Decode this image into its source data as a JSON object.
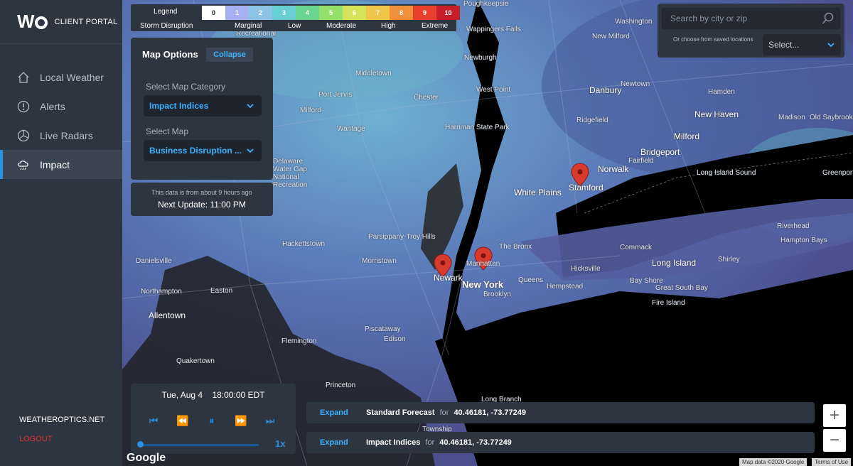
{
  "sidebar": {
    "brand_logo": "WO",
    "brand_sub": "CLIENT PORTAL",
    "items": [
      {
        "label": "Local Weather",
        "icon": "home-icon"
      },
      {
        "label": "Alerts",
        "icon": "alert-icon"
      },
      {
        "label": "Live Radars",
        "icon": "radar-icon"
      },
      {
        "label": "Impact",
        "icon": "cloud-rain-icon",
        "active": true
      }
    ],
    "site_link": "WEATHEROPTICS.NET",
    "logout": "LOGOUT"
  },
  "legend": {
    "title": "Legend",
    "row_label": "Storm Disruption",
    "cells": [
      {
        "v": "0",
        "c": "#ffffff",
        "t": "#111111"
      },
      {
        "v": "1",
        "c": "#a7b0f0",
        "t": "#ffffff"
      },
      {
        "v": "2",
        "c": "#8ec3e8",
        "t": "#ffffff"
      },
      {
        "v": "3",
        "c": "#67cfd3",
        "t": "#ffffff"
      },
      {
        "v": "4",
        "c": "#68d690",
        "t": "#ffffff"
      },
      {
        "v": "5",
        "c": "#93e06a",
        "t": "#ffffff"
      },
      {
        "v": "6",
        "c": "#d5e25a",
        "t": "#ffffff"
      },
      {
        "v": "7",
        "c": "#efc54a",
        "t": "#ffffff"
      },
      {
        "v": "8",
        "c": "#f0903a",
        "t": "#ffffff"
      },
      {
        "v": "9",
        "c": "#e8402c",
        "t": "#ffffff"
      },
      {
        "v": "10",
        "c": "#c81e2a",
        "t": "#ffffff"
      }
    ],
    "levels": [
      "Marginal",
      "Low",
      "Moderate",
      "High",
      "Extreme"
    ]
  },
  "options": {
    "title": "Map Options",
    "collapse": "Collapse",
    "category_label": "Select Map Category",
    "category_value": "Impact Indices",
    "map_label": "Select Map",
    "map_value": "Business Disruption ..."
  },
  "data_note": {
    "age": "This data is from about 9 hours ago",
    "next_update": "Next Update: 11:00 PM"
  },
  "search": {
    "placeholder": "Search by city or zip",
    "saved_label": "Or choose from saved locations",
    "saved_select": "Select..."
  },
  "playback": {
    "date": "Tue, Aug 4",
    "time": "18:00:00 EDT",
    "speed": "1x",
    "progress": 0.0
  },
  "forecast_bars": [
    {
      "expand": "Expand",
      "name": "Standard Forecast",
      "for": "for",
      "coord": "40.46181, -73.77249"
    },
    {
      "expand": "Expand",
      "name": "Impact Indices",
      "for": "for",
      "coord": "40.46181, -73.77249"
    }
  ],
  "zoom": {
    "in": "+",
    "out": "−"
  },
  "map_labels": [
    "Newburgh",
    "Middletown",
    "Port Jervis",
    "Chester",
    "West Point",
    "Milford",
    "Wantage",
    "Harriman State Park",
    "Hackettstown",
    "Parsippany-Troy Hills",
    "Morristown",
    "Newark",
    "New York",
    "White Plains",
    "Stamford",
    "Norwalk",
    "Bridgeport",
    "Fairfield",
    "Milford",
    "New Haven",
    "Danbury",
    "Newtown",
    "Ridgefield",
    "New Milford",
    "Washington",
    "Hamden",
    "Madison",
    "Old Saybrook",
    "Greenport",
    "Riverhead",
    "Hampton Bays",
    "Shirley",
    "Commack",
    "Long Island",
    "Bay Shore",
    "Fire Island",
    "Hicksville",
    "Hempstead",
    "Queens",
    "Brooklyn",
    "The Bronx",
    "Manhattan",
    "Edison",
    "Piscataway",
    "Princeton",
    "Flemington",
    "Allentown",
    "Easton",
    "Northampton",
    "Danielsville",
    "Quakertown",
    "Long Branch",
    "Township",
    "Long Island Sound",
    "Great South Bay",
    "Wappingers Falls",
    "Poughkeepsie",
    "Recreational",
    "Delaware Water Gap National Recreation"
  ],
  "map_footer": {
    "brand": "Google",
    "data": "Map data ©2020 Google",
    "terms": "Terms of Use"
  }
}
